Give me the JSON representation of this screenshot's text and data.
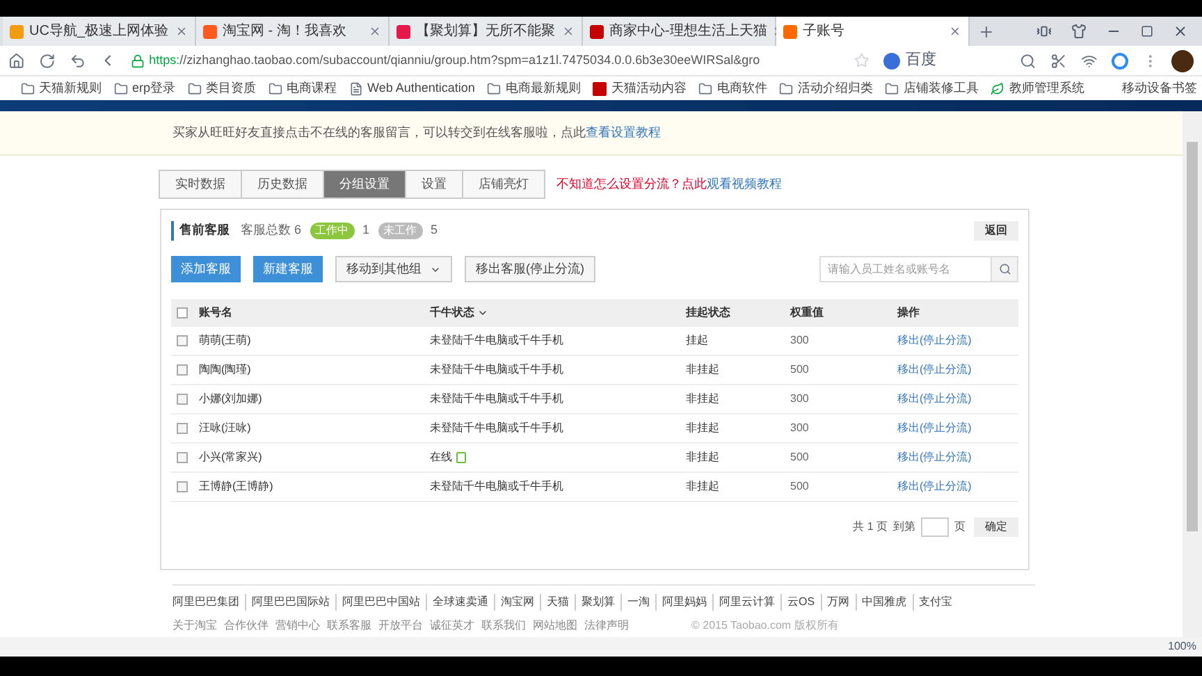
{
  "browser_tabs": [
    {
      "title": "UC导航_极速上网体验",
      "selected": false,
      "color": "#f39c12"
    },
    {
      "title": "淘宝网 - 淘！我喜欢",
      "selected": false,
      "color": "#ff5a1f"
    },
    {
      "title": "【聚划算】无所不能聚",
      "selected": false,
      "color": "#e6194b"
    },
    {
      "title": "商家中心-理想生活上天猫",
      "selected": false,
      "color": "#c40000"
    },
    {
      "title": "子账号",
      "selected": true,
      "color": "#ff6a00"
    }
  ],
  "address": {
    "scheme": "https:",
    "url": "//zizhanghao.taobao.com/subaccount/qianniu/group.htm?spm=a1z1l.7475034.0.0.6b3e30eeWIRSal&gro",
    "search_engine": "百度"
  },
  "bookmarks": [
    {
      "label": "天猫新规则",
      "kind": "folder"
    },
    {
      "label": "erp登录",
      "kind": "folder"
    },
    {
      "label": "类目资质",
      "kind": "folder"
    },
    {
      "label": "电商课程",
      "kind": "folder"
    },
    {
      "label": "Web Authentication",
      "kind": "page"
    },
    {
      "label": "电商最新规则",
      "kind": "folder"
    },
    {
      "label": "天猫活动内容",
      "kind": "tmall"
    },
    {
      "label": "电商软件",
      "kind": "folder"
    },
    {
      "label": "活动介绍归类",
      "kind": "folder"
    },
    {
      "label": "店铺装修工具",
      "kind": "folder"
    },
    {
      "label": "教师管理系统",
      "kind": "leaf"
    }
  ],
  "mobile_bookmarks": "移动设备书签",
  "notice": {
    "text": "买家从旺旺好友直接点击不在线的客服留言，可以转交到在线客服啦，点此",
    "link": "查看设置教程"
  },
  "tabs": [
    {
      "label": "实时数据",
      "selected": false
    },
    {
      "label": "历史数据",
      "selected": false
    },
    {
      "label": "分组设置",
      "selected": true
    },
    {
      "label": "设置",
      "selected": false
    },
    {
      "label": "店铺亮灯",
      "selected": false
    }
  ],
  "help": {
    "text": "不知道怎么设置分流？点此",
    "link": "观看视频教程"
  },
  "group": {
    "name": "售前客服",
    "total_label": "客服总数 6",
    "working_badge": "工作中",
    "working_count": "1",
    "idle_badge": "未工作",
    "idle_count": "5",
    "back": "返回"
  },
  "actions": [
    {
      "label": "添加客服",
      "kind": "primary"
    },
    {
      "label": "新建客服",
      "kind": "primary"
    },
    {
      "label": "移动到其他组",
      "kind": "dropdown"
    },
    {
      "label": "移出客服(停止分流)",
      "kind": "plain"
    }
  ],
  "search": {
    "placeholder": "请输入员工姓名或账号名"
  },
  "table": {
    "all_checked": false,
    "columns": [
      "账号名",
      "千牛状态",
      "挂起状态",
      "权重值",
      "操作"
    ],
    "rows": [
      {
        "name": "萌萌(王萌)",
        "status": "未登陆千牛电脑或千牛手机",
        "online": false,
        "suspend": "挂起",
        "weight": "300",
        "action": "移出(停止分流)",
        "checked": false
      },
      {
        "name": "陶陶(陶瑾)",
        "status": "未登陆千牛电脑或千牛手机",
        "online": false,
        "suspend": "非挂起",
        "weight": "500",
        "action": "移出(停止分流)",
        "checked": false
      },
      {
        "name": "小娜(刘加娜)",
        "status": "未登陆千牛电脑或千牛手机",
        "online": false,
        "suspend": "非挂起",
        "weight": "300",
        "action": "移出(停止分流)",
        "checked": false
      },
      {
        "name": "汪咏(汪咏)",
        "status": "未登陆千牛电脑或千牛手机",
        "online": false,
        "suspend": "非挂起",
        "weight": "300",
        "action": "移出(停止分流)",
        "checked": false
      },
      {
        "name": "小兴(常家兴)",
        "status": "在线",
        "online": true,
        "suspend": "非挂起",
        "weight": "500",
        "action": "移出(停止分流)",
        "checked": false
      },
      {
        "name": "王博静(王博静)",
        "status": "未登陆千牛电脑或千牛手机",
        "online": false,
        "suspend": "非挂起",
        "weight": "500",
        "action": "移出(停止分流)",
        "checked": false
      }
    ]
  },
  "pagination": {
    "total": "共 1 页",
    "goto": "到第",
    "unit": "页",
    "confirm": "确定"
  },
  "footer": {
    "links": [
      "阿里巴巴集团",
      "阿里巴巴国际站",
      "阿里巴巴中国站",
      "全球速卖通",
      "淘宝网",
      "天猫",
      "聚划算",
      "一淘",
      "阿里妈妈",
      "阿里云计算",
      "云OS",
      "万网",
      "中国雅虎",
      "支付宝"
    ],
    "links2": [
      "关于淘宝",
      "合作伙伴",
      "营销中心",
      "联系客服",
      "开放平台",
      "诚征英才",
      "联系我们",
      "网站地图",
      "法律声明"
    ],
    "copyright": "© 2015 Taobao.com 版权所有"
  },
  "zoom": "100%"
}
